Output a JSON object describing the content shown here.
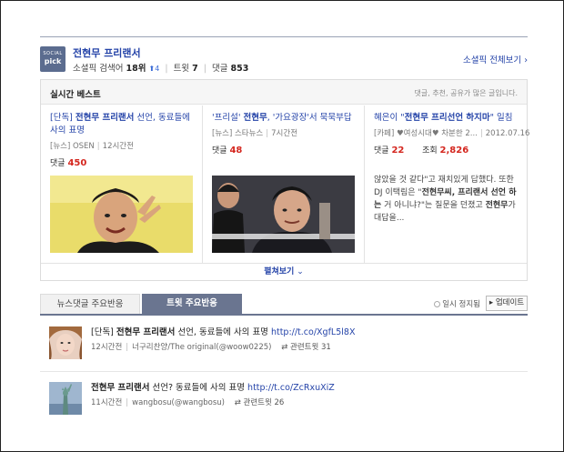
{
  "header": {
    "logo_line1": "SOCIAL",
    "logo_line2": "pick",
    "title": "전현무 프리랜서",
    "stat_label": "소셜픽 검색어",
    "rank": "18위",
    "rank_change": "4",
    "tweet_label": "트윗",
    "tweet_count": "7",
    "comment_label": "댓글",
    "comment_count": "853",
    "more_link": "소셜픽 전체보기"
  },
  "best": {
    "title": "실시간 베스트",
    "note": "댓글, 추천, 공유가 많은 글입니다.",
    "items": [
      {
        "title_pre": "[단독] ",
        "title_bold": "전현무 프리랜서",
        "title_post": " 선언, 동료들에 사의 표명",
        "source": "[뉴스] OSEN",
        "time": "12시간전",
        "comment_label": "댓글",
        "comment_count": "450"
      },
      {
        "title_pre": "'프리설' ",
        "title_bold": "전현무",
        "title_post": ", '가요광장'서 묵묵부답",
        "source": "[뉴스] 스타뉴스",
        "time": "7시간전",
        "comment_label": "댓글",
        "comment_count": "48"
      },
      {
        "title_pre": "혜은이 \"",
        "title_bold": "전현무 프리선언 하지마",
        "title_post": "\" 일침",
        "source": "[카페] ♥여성시대♥ 차분한 2...",
        "time": "2012.07.16",
        "comment_label": "댓글",
        "comment_count": "22",
        "view_label": "조회",
        "view_count": "2,826",
        "body_pre": "않았을 것 같다\"고 재치있게 답했다. 또한 DJ 이택림은 \"",
        "body_bold1": "전현무씨, 프리랜서 선언 하는",
        "body_mid": " 거 아니냐?\"는 질문을 던졌고 ",
        "body_bold2": "전현무",
        "body_post": "가 대답을..."
      }
    ],
    "expand_label": "펼쳐보기"
  },
  "tabs": {
    "tab1": "뉴스댓글 주요반응",
    "tab2": "트윗 주요반응",
    "pause": "일시 정지됨",
    "update": "업데이트"
  },
  "tweets": [
    {
      "text_pre": "[단독] ",
      "text_bold": "전현무 프리랜서",
      "text_post": " 선언, 동료들에 사의 표명 ",
      "link": "http://t.co/XgfL5l8X",
      "time": "12시간전",
      "user": "너구리찬양/The original(@woow0225)",
      "rt_label": "관련트윗",
      "rt_count": "31"
    },
    {
      "text_pre": "",
      "text_bold": "전현무 프리랜서",
      "text_post": " 선언? 동료들에 사의 표명 ",
      "link": "http://t.co/ZcRxuXiZ",
      "time": "11시간전",
      "user": "wangbosu(@wangbosu)",
      "rt_label": "관련트윗",
      "rt_count": "26"
    }
  ],
  "colors": {
    "link_blue": "#2443a8",
    "count_red": "#d4261e",
    "tab_active": "#6a7590",
    "logo_bg": "#5b6c8f"
  }
}
